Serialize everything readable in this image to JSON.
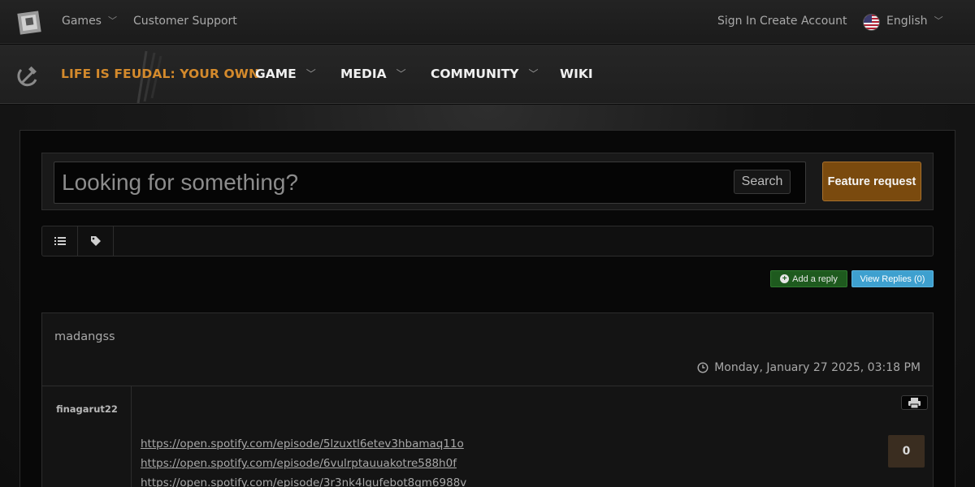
{
  "topbar": {
    "games_label": "Games",
    "support_label": "Customer Support",
    "sign_in_label": "Sign In",
    "create_account_label": "Create Account",
    "language_label": "English",
    "logo_icon": "game-logo-icon",
    "flag_icon": "us-flag-icon"
  },
  "nav": {
    "brand": "LIFE IS FEUDAL: YOUR OWN",
    "items": [
      {
        "label": "GAME",
        "has_dropdown": true
      },
      {
        "label": "MEDIA",
        "has_dropdown": true
      },
      {
        "label": "COMMUNITY",
        "has_dropdown": true
      },
      {
        "label": "WIKI",
        "has_dropdown": false
      }
    ],
    "brand_color": "#d48a2c"
  },
  "search": {
    "placeholder": "Looking for something?",
    "button_label": "Search",
    "feature_request_label": "Feature request"
  },
  "toolbar": {
    "list_icon": "list-icon",
    "tag_icon": "tag-icon"
  },
  "actions": {
    "add_reply_label": "Add a reply",
    "view_replies_label": "View Replies (0)"
  },
  "post": {
    "title": "madangss",
    "date": "Monday, January 27 2025, 03:18 PM",
    "author": "finagarut22",
    "vote_count": "0",
    "links": [
      "https://open.spotify.com/episode/5lzuxtl6etev3hbamaq11o",
      "https://open.spotify.com/episode/6vulrptauuakotre588h0f",
      "https://open.spotify.com/episode/3r3nk4lqufebot8qm6988v"
    ]
  }
}
